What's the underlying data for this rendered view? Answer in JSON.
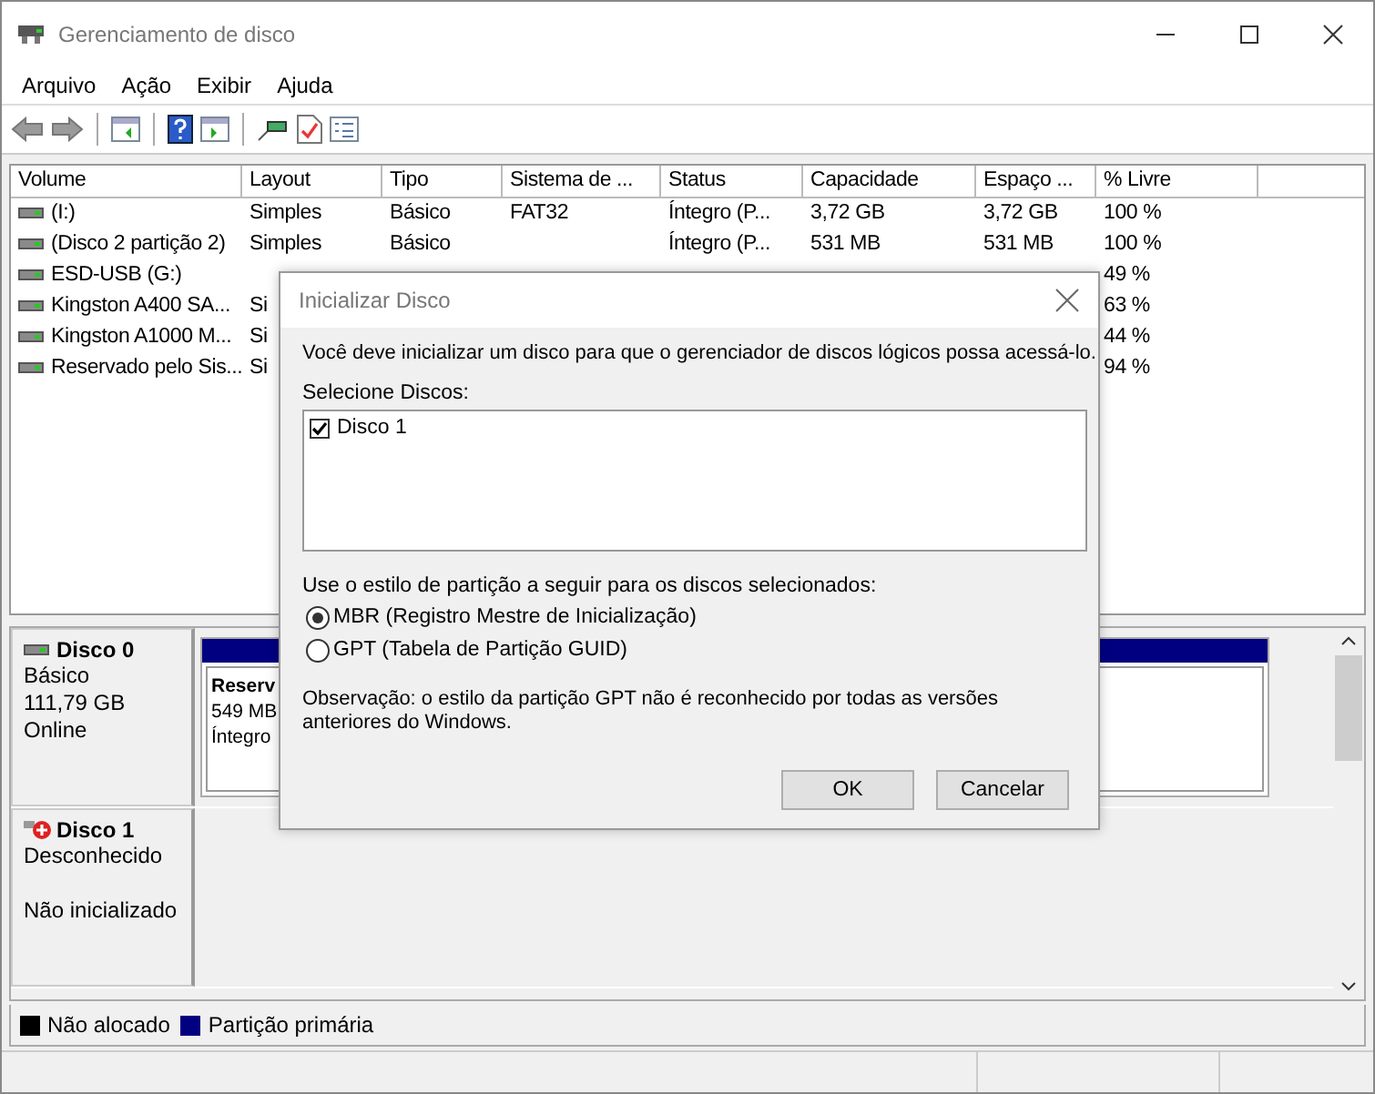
{
  "window": {
    "title": "Gerenciamento de disco"
  },
  "menu": [
    "Arquivo",
    "Ação",
    "Exibir",
    "Ajuda"
  ],
  "table": {
    "columns": [
      "Volume",
      "Layout",
      "Tipo",
      "Sistema de ...",
      "Status",
      "Capacidade",
      "Espaço ...",
      "% Livre"
    ],
    "rows": [
      {
        "volume": "(I:)",
        "layout": "Simples",
        "type": "Básico",
        "file_system": "FAT32",
        "status": "Íntegro (P...",
        "capacity": "3,72 GB",
        "free_space": "3,72 GB",
        "percent_free": "100 %"
      },
      {
        "volume": "(Disco 2 partição 2)",
        "layout": "Simples",
        "type": "Básico",
        "status": "Íntegro (P...",
        "capacity": "531 MB",
        "free_space": "531 MB",
        "percent_free": "100 %"
      },
      {
        "volume": "ESD-USB (G:)",
        "percent_free": "49 %"
      },
      {
        "volume": "Kingston A400 SA...",
        "layout": "Si",
        "percent_free": "63 %"
      },
      {
        "volume": "Kingston A1000 M...",
        "layout": "Si",
        "percent_free": "44 %"
      },
      {
        "volume": "Reservado pelo Sis...",
        "layout": "Si",
        "percent_free": "94 %"
      }
    ]
  },
  "disks": [
    {
      "name": "Disco 0",
      "kind": "online",
      "type": "Básico",
      "size": "111,79 GB",
      "state": "Online",
      "partitions": [
        {
          "name": "Reserv",
          "size": "549 MB",
          "status": "Íntegro"
        }
      ]
    },
    {
      "name": "Disco 1",
      "kind": "error",
      "type": "Desconhecido",
      "state": "Não inicializado"
    }
  ],
  "legend": [
    {
      "label": "Não alocado",
      "color": "#000000"
    },
    {
      "label": "Partição primária",
      "color": "#000080"
    }
  ],
  "dialog": {
    "title": "Inicializar Disco",
    "message": "Você deve inicializar um disco para que o gerenciador de discos lógicos possa acessá-lo.",
    "select_label": "Selecione Discos:",
    "disks": [
      {
        "label": "Disco 1",
        "checked": true
      }
    ],
    "style_label": "Use o estilo de partição a seguir para os discos selecionados:",
    "options": [
      {
        "label": "MBR (Registro Mestre de Inicialização)",
        "selected": true
      },
      {
        "label": "GPT (Tabela de Partição GUID)",
        "selected": false
      }
    ],
    "note": "Observação: o estilo da partição GPT não é reconhecido por todas as versões anteriores do Windows.",
    "buttons": [
      "OK",
      "Cancelar"
    ]
  }
}
